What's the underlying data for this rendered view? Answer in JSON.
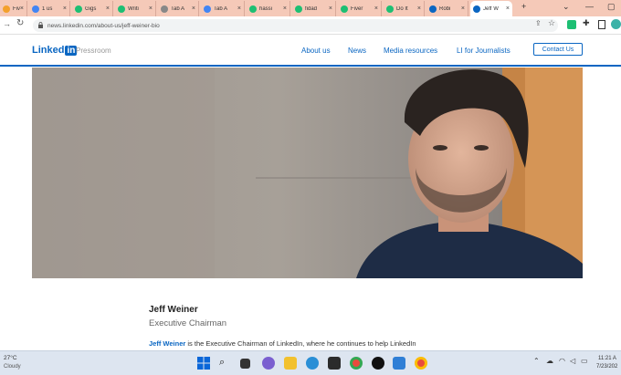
{
  "browser": {
    "tabs": [
      {
        "label": "Fiver",
        "color": "#f3a02c"
      },
      {
        "label": "1 us",
        "color": "#4285f4"
      },
      {
        "label": "Gigs",
        "color": "#1dbf73"
      },
      {
        "label": "Writi",
        "color": "#1dbf73"
      },
      {
        "label": "Tab A",
        "color": "#888888"
      },
      {
        "label": "Tab A",
        "color": "#4285f4"
      },
      {
        "label": "hassi",
        "color": "#1dbf73"
      },
      {
        "label": "fidad",
        "color": "#1dbf73"
      },
      {
        "label": "Fiver",
        "color": "#1dbf73"
      },
      {
        "label": "Do It",
        "color": "#1dbf73"
      },
      {
        "label": "Robi",
        "color": "#0a66c2"
      },
      {
        "label": "Jeff W",
        "color": "#0a66c2"
      }
    ],
    "new_tab_symbol": "+",
    "url": "news.linkedin.com/about-us/jeff-weiner-bio"
  },
  "site": {
    "logo_word": "Linked",
    "logo_in": "in",
    "section": "Pressroom",
    "nav": [
      "About us",
      "News",
      "Media resources",
      "LI for Journalists"
    ],
    "contact_label": "Contact Us"
  },
  "profile": {
    "name": "Jeff Weiner",
    "title": "Executive Chairman",
    "bio_name": "Jeff Weiner",
    "bio_rest": " is the Executive Chairman of LinkedIn, where he continues to help LinkedIn"
  },
  "taskbar": {
    "weather_temp": "27°C",
    "weather_cond": "Cloudy",
    "time": "11:21 A",
    "date": "7/23/202"
  }
}
